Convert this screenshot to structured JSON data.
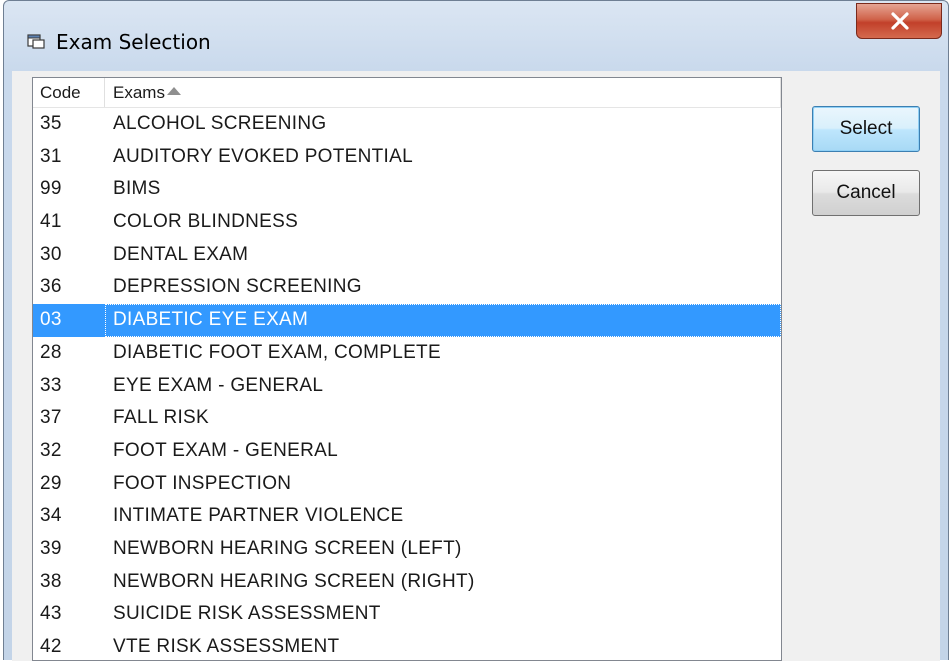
{
  "window": {
    "title": "Exam Selection"
  },
  "list": {
    "columns": {
      "code": "Code",
      "exams": "Exams"
    },
    "rows": [
      {
        "code": "35",
        "exam": "ALCOHOL SCREENING"
      },
      {
        "code": "31",
        "exam": "AUDITORY EVOKED POTENTIAL"
      },
      {
        "code": "99",
        "exam": "BIMS"
      },
      {
        "code": "41",
        "exam": "COLOR BLINDNESS"
      },
      {
        "code": "30",
        "exam": "DENTAL EXAM"
      },
      {
        "code": "36",
        "exam": "DEPRESSION SCREENING"
      },
      {
        "code": "03",
        "exam": "DIABETIC EYE EXAM"
      },
      {
        "code": "28",
        "exam": "DIABETIC FOOT EXAM, COMPLETE"
      },
      {
        "code": "33",
        "exam": "EYE EXAM - GENERAL"
      },
      {
        "code": "37",
        "exam": "FALL RISK"
      },
      {
        "code": "32",
        "exam": "FOOT EXAM - GENERAL"
      },
      {
        "code": "29",
        "exam": "FOOT INSPECTION"
      },
      {
        "code": "34",
        "exam": "INTIMATE PARTNER VIOLENCE"
      },
      {
        "code": "39",
        "exam": "NEWBORN HEARING SCREEN (LEFT)"
      },
      {
        "code": "38",
        "exam": "NEWBORN HEARING SCREEN (RIGHT)"
      },
      {
        "code": "43",
        "exam": "SUICIDE RISK ASSESSMENT"
      },
      {
        "code": "42",
        "exam": "VTE RISK ASSESSMENT"
      }
    ],
    "selected_index": 6,
    "sort_column": "exams",
    "sort_direction": "ascending"
  },
  "buttons": {
    "select_label": "Select",
    "cancel_label": "Cancel"
  },
  "colors": {
    "selection": "#3399ff",
    "close_button": "#c2402a",
    "default_button_border": "#3c7fb1"
  },
  "icons": {
    "title": "window-icon",
    "close": "close-icon",
    "sort": "sort-ascending-icon"
  }
}
